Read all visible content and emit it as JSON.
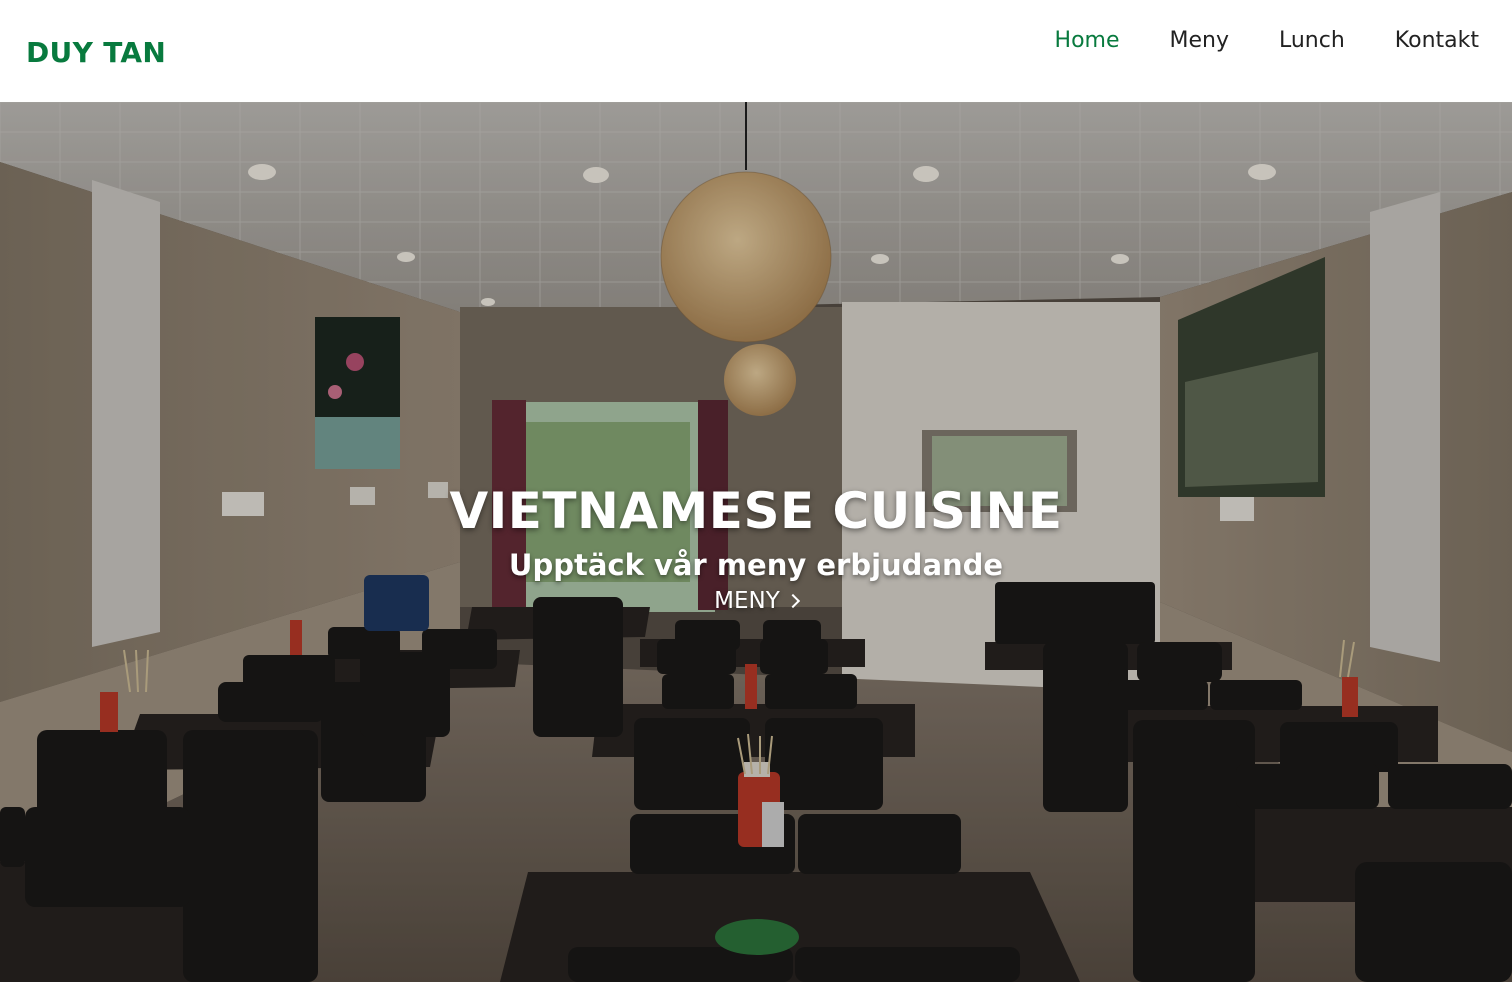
{
  "brand": {
    "name": "DUY TAN",
    "color": "#087a3e"
  },
  "nav": {
    "items": [
      {
        "label": "Home",
        "active": true
      },
      {
        "label": "Meny",
        "active": false
      },
      {
        "label": "Lunch",
        "active": false
      },
      {
        "label": "Kontakt",
        "active": false
      }
    ]
  },
  "hero": {
    "title": "VIETNAMESE CUISINE",
    "subtitle": "Upptäck vår meny erbjudande",
    "cta_label": "MENY",
    "cta_icon": "chevron-right-icon",
    "background": "restaurant-interior-photo"
  }
}
